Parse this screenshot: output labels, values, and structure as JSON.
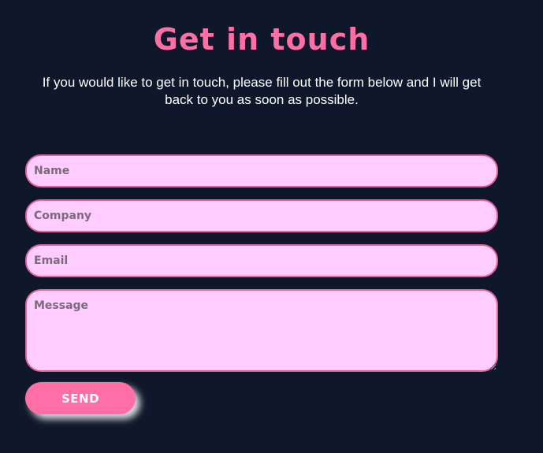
{
  "heading": "Get in touch",
  "intro": "If you would like to get in touch, please fill out the form below and I will get back to you as soon as possible.",
  "form": {
    "name_placeholder": "Name",
    "company_placeholder": "Company",
    "email_placeholder": "Email",
    "message_placeholder": "Message",
    "send_label": "SEND"
  },
  "colors": {
    "background": "#0f172a",
    "accent": "#ff6fa5",
    "field_background": "#ffccff",
    "field_border": "#e0639a"
  }
}
